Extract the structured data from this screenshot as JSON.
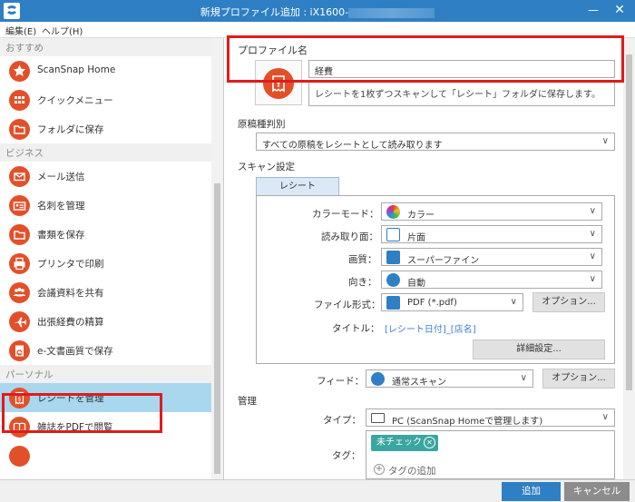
{
  "window": {
    "title_prefix": "新規プロファイル追加 : iX1600-",
    "minimize_glyph": "—",
    "close_glyph": "✕"
  },
  "menu": {
    "edit": "編集(E)",
    "help": "ヘルプ(H)"
  },
  "sidebar": {
    "section_recommended": "おすすめ",
    "section_business": "ビジネス",
    "section_personal": "パーソナル",
    "items": [
      {
        "label": "ScanSnap Home",
        "icon": "star-icon",
        "color": "#e2502a"
      },
      {
        "label": "クイックメニュー",
        "icon": "grid-icon",
        "color": "#e2502a"
      },
      {
        "label": "フォルダに保存",
        "icon": "folder-icon",
        "color": "#e2502a"
      },
      {
        "label": "メール送信",
        "icon": "mail-icon",
        "color": "#e2502a"
      },
      {
        "label": "名刺を管理",
        "icon": "business-card-icon",
        "color": "#e2502a"
      },
      {
        "label": "書類を保存",
        "icon": "folder-icon",
        "color": "#e2502a"
      },
      {
        "label": "プリンタで印刷",
        "icon": "printer-icon",
        "color": "#e2502a"
      },
      {
        "label": "会議資料を共有",
        "icon": "people-icon",
        "color": "#e2502a"
      },
      {
        "label": "出張経費の精算",
        "icon": "airplane-icon",
        "color": "#e2502a"
      },
      {
        "label": "e-文書画質で保存",
        "icon": "e-document-icon",
        "color": "#e2502a"
      },
      {
        "label": "レシートを管理",
        "icon": "receipt-icon",
        "color": "#e2502a"
      },
      {
        "label": "雑誌をPDFで閲覧",
        "icon": "book-icon",
        "color": "#e2502a"
      },
      {
        "label": "",
        "icon": "partial-icon",
        "color": "#e2502a"
      }
    ]
  },
  "profile": {
    "header": "プロファイル名",
    "name_value": "経費",
    "description": "レシートを1枚ずつスキャンして「レシート」フォルダに保存します。"
  },
  "doc_type": {
    "label": "原稿種判別",
    "value": "すべての原稿をレシートとして読み取ります"
  },
  "scan": {
    "label": "スキャン設定",
    "tab": "レシート",
    "color_mode_label": "カラーモード：",
    "color_mode_value": "カラー",
    "side_label": "読み取り面：",
    "side_value": "片面",
    "quality_label": "画質：",
    "quality_value": "スーパーファイン",
    "orientation_label": "向き：",
    "orientation_value": "自動",
    "format_label": "ファイル形式：",
    "format_value": "PDF (*.pdf)",
    "options_label": "オプション...",
    "title_label": "タイトル：",
    "title_value": "[レシート日付]_[店名]",
    "detail_label": "詳細設定...",
    "feed_label": "フィード：",
    "feed_value": "通常スキャン",
    "feed_options_label": "オプション..."
  },
  "manage": {
    "label": "管理",
    "type_label": "タイプ：",
    "type_value": "PC (ScanSnap Homeで管理します)",
    "tags_label": "タグ：",
    "tag_chip": "未チェック",
    "add_tag": "タグの追加"
  },
  "footer": {
    "add": "追加",
    "cancel": "キャンセル"
  },
  "colors": {
    "accent": "#2f7fc4",
    "icon_orange": "#e2502a",
    "selected": "#a9d7ee",
    "annotation": "#e01b1b"
  }
}
